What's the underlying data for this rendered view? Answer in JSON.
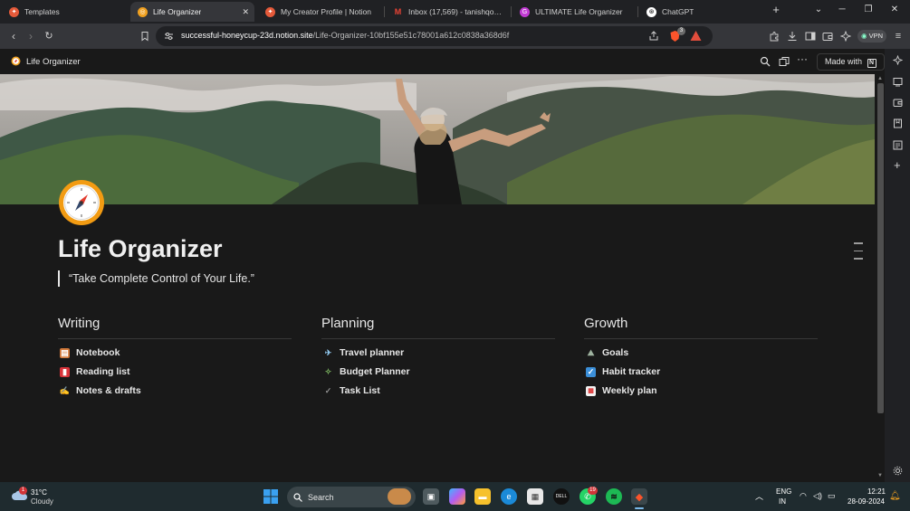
{
  "browser": {
    "tabs": [
      {
        "label": "Templates",
        "icon": "notion-templates-icon",
        "active": false
      },
      {
        "label": "Life Organizer",
        "icon": "compass-icon",
        "active": true
      },
      {
        "label": "My Creator Profile | Notion",
        "icon": "notion-icon",
        "active": false
      },
      {
        "label": "Inbox (17,569) - tanishqontop@",
        "icon": "gmail-icon",
        "active": false
      },
      {
        "label": "ULTIMATE Life Organizer",
        "icon": "guide-icon",
        "active": false
      },
      {
        "label": "ChatGPT",
        "icon": "chatgpt-icon",
        "active": false
      }
    ],
    "url_domain": "successful-honeycup-23d.notion.site",
    "url_path": "/Life-Organizer-10bf155e51c78001a612c0838a368d6f",
    "vpn_label": "VPN",
    "shield_badge": "3",
    "accent_color": "#fb542b"
  },
  "notion": {
    "header_title": "Life Organizer",
    "made_with_label": "Made with",
    "page_title": "Life Organizer",
    "quote": "“Take Complete Control of Your Life.”",
    "columns": [
      {
        "heading": "Writing",
        "items": [
          {
            "label": "Notebook",
            "icon": "notebook-icon"
          },
          {
            "label": "Reading list",
            "icon": "red-book-icon"
          },
          {
            "label": "Notes & drafts",
            "icon": "writing-hand-icon"
          }
        ]
      },
      {
        "heading": "Planning",
        "items": [
          {
            "label": "Travel planner",
            "icon": "airplane-icon"
          },
          {
            "label": "Budget Planner",
            "icon": "money-icon"
          },
          {
            "label": "Task List",
            "icon": "checkmark-icon"
          }
        ]
      },
      {
        "heading": "Growth",
        "items": [
          {
            "label": "Goals",
            "icon": "mountain-icon"
          },
          {
            "label": "Habit tracker",
            "icon": "checkbox-icon"
          },
          {
            "label": "Weekly plan",
            "icon": "calendar-icon"
          }
        ]
      }
    ]
  },
  "taskbar": {
    "weather_temp": "31°C",
    "weather_cond": "Cloudy",
    "weather_badge": "1",
    "search_label": "Search",
    "whatsapp_badge": "19",
    "lang_line1": "ENG",
    "lang_line2": "IN",
    "time": "12:21",
    "date": "28-09-2024"
  }
}
